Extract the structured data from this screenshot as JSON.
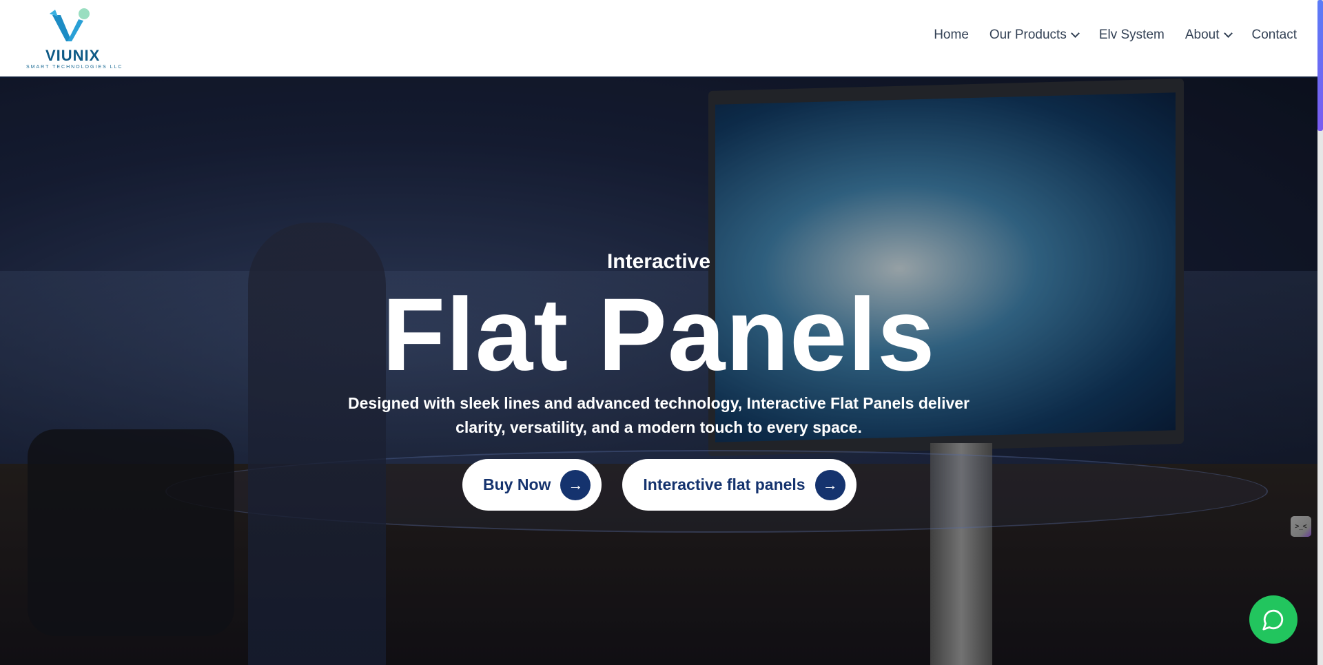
{
  "header": {
    "logo": {
      "brand": "VIUNIX",
      "tagline": "SMART TECHNOLOGIES LLC"
    },
    "nav": [
      {
        "label": "Home"
      },
      {
        "label": "Our Products",
        "dropdown": true
      },
      {
        "label": "Elv System"
      },
      {
        "label": "About",
        "dropdown": true
      },
      {
        "label": "Contact"
      }
    ]
  },
  "hero": {
    "kicker": "Interactive",
    "title": "Flat Panels",
    "description_line1": "Designed with sleek lines and advanced technology, Interactive Flat Panels deliver",
    "description_line2": "clarity, versatility, and a modern touch to every space.",
    "buttons": [
      {
        "label": "Buy Now",
        "icon": "arrow-right-icon"
      },
      {
        "label": "Interactive flat panels",
        "icon": "arrow-right-icon"
      }
    ]
  },
  "widget": {
    "label": ">_<"
  },
  "chat": {
    "icon": "chat-bubble-icon",
    "color": "#22c55e"
  },
  "colors": {
    "accent": "#15336e",
    "brand": "#0e5a86"
  }
}
